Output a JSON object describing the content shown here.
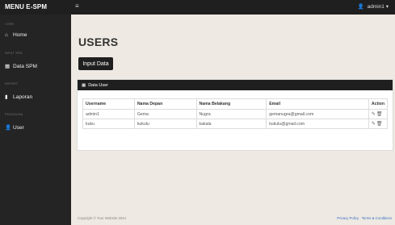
{
  "topbar": {
    "brand": "MENU E-SPM",
    "menu_icon": "bars-icon",
    "user": "admin1"
  },
  "sidebar": {
    "sections": [
      {
        "title": "CORE",
        "item": "Home",
        "icon": "home-icon"
      },
      {
        "title": "INPUT SPM",
        "item": "Data SPM",
        "icon": "table-icon"
      },
      {
        "title": "REPORT",
        "item": "Laporan",
        "icon": "file-icon"
      },
      {
        "title": "PENGGUNA",
        "item": "User",
        "icon": "user-icon"
      }
    ]
  },
  "main": {
    "title": "USERS",
    "input_button": "Input Data",
    "card_title": "Data User",
    "columns": [
      "Username",
      "Nama Depan",
      "Nama Belakang",
      "Email",
      "Action"
    ],
    "rows": [
      [
        "admin1",
        "Gema",
        "Nugra",
        "gemanugra@gmail.com"
      ],
      [
        "kuku",
        "kukulu",
        "kakala",
        "kukulu@gmail.com"
      ]
    ]
  },
  "footer": {
    "copyright": "Copyright © Your Website 2024",
    "privacy": "Privacy Policy",
    "separator": "·",
    "terms": "Terms & Conditions"
  }
}
